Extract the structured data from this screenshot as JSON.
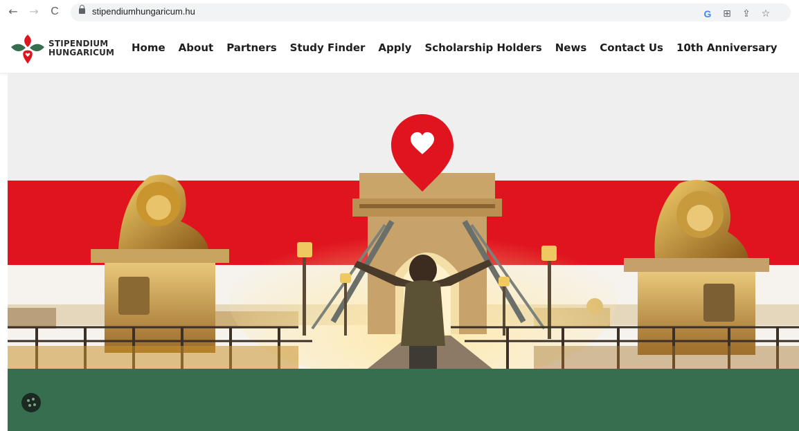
{
  "browser": {
    "back_icon": "←",
    "forward_icon": "→",
    "reload_icon": "C",
    "url": "stipendiumhungaricum.hu",
    "google_icon": "G",
    "translate_icon": "⊞",
    "share_icon": "⇪",
    "bookmark_icon": "☆"
  },
  "site": {
    "logo_line1": "STIPENDIUM",
    "logo_line2": "HUNGARICUM",
    "nav": [
      "Home",
      "About",
      "Partners",
      "Study Finder",
      "Apply",
      "Scholarship Holders",
      "News",
      "Contact Us",
      "10th Anniversary"
    ]
  },
  "colors": {
    "brand_red": "#e0141e",
    "brand_green": "#376e50",
    "hero_top": "#efefef"
  },
  "icons": {
    "heart_pin": "heart-map-pin-icon",
    "cookie": "cookie-settings-icon"
  }
}
